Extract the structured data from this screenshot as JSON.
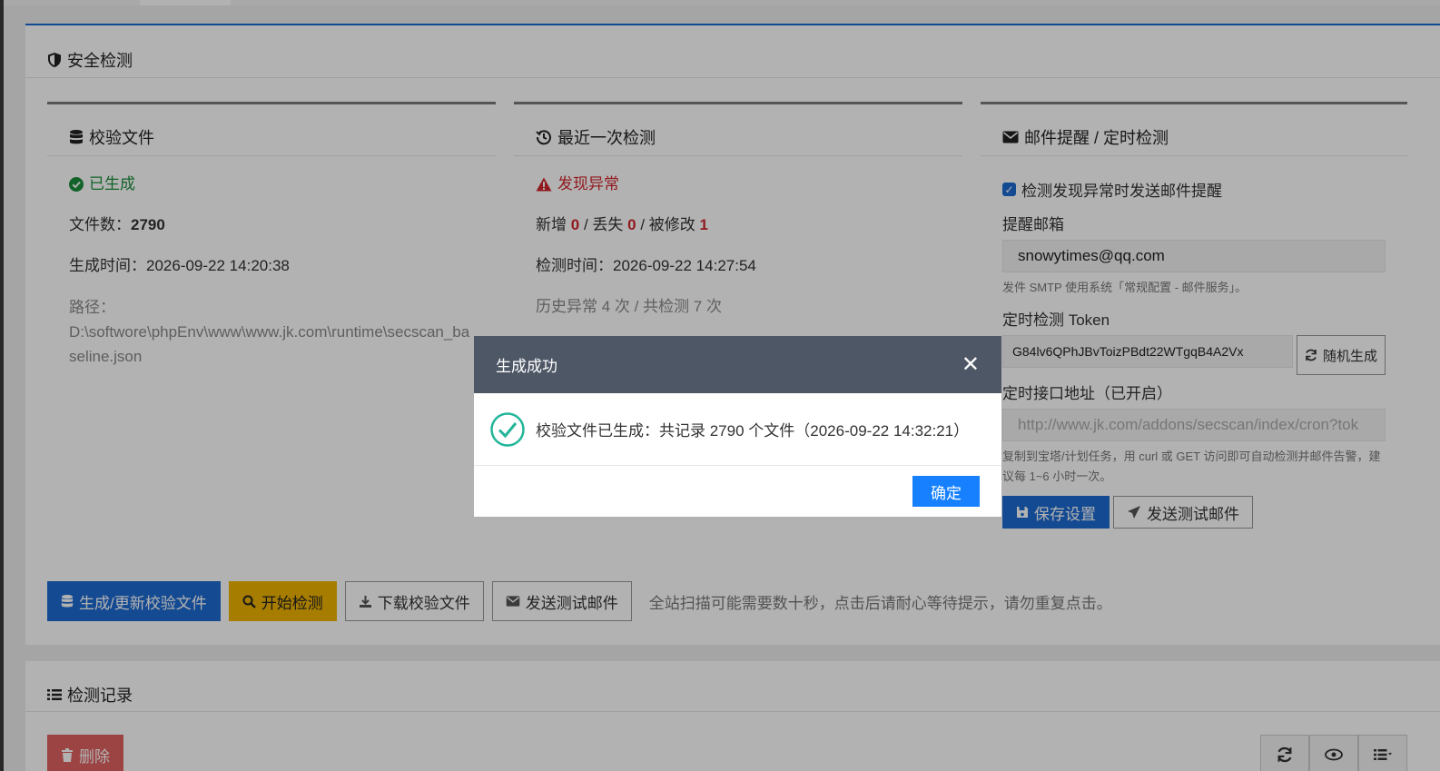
{
  "section": {
    "title": "安全检测"
  },
  "baseline": {
    "title": "校验文件",
    "status": "已生成",
    "file_count_label": "文件数：",
    "file_count": "2790",
    "generated_label": "生成时间：",
    "generated_time": "2026-09-22 14:20:38",
    "path_label": "路径：",
    "path": "D:\\softwore\\phpEnv\\www\\www.jk.com\\runtime\\secscan_baseline.json"
  },
  "last_scan": {
    "title": "最近一次检测",
    "status": "发现异常",
    "added_label": "新增",
    "added": "0",
    "lost_label": "/ 丢失",
    "lost": "0",
    "modified_label": "/ 被修改",
    "modified": "1",
    "scan_time_label": "检测时间：",
    "scan_time": "2026-09-22 14:27:54",
    "history": "历史异常 4 次 / 共检测 7 次"
  },
  "mail": {
    "title": "邮件提醒 / 定时检测",
    "checkbox_label": "检测发现异常时发送邮件提醒",
    "email_label": "提醒邮箱",
    "email_value": "snowytimes@qq.com",
    "smtp_hint": "发件 SMTP 使用系统「常规配置 - 邮件服务」。",
    "token_label": "定时检测 Token",
    "token_value": "G84lv6QPhJBvToizPBdt22WTgqB4A2Vx",
    "random_button": "随机生成",
    "cron_label": "定时接口地址（已开启）",
    "cron_placeholder": "http://www.jk.com/addons/secscan/index/cron?tok",
    "cron_hint": "复制到宝塔/计划任务，用 curl 或 GET 访问即可自动检测并邮件告警，建议每 1~6 小时一次。",
    "save_button": "保存设置",
    "test_button": "发送测试邮件"
  },
  "actions": {
    "generate": "生成/更新校验文件",
    "scan": "开始检测",
    "download": "下载校验文件",
    "test_mail": "发送测试邮件",
    "note": "全站扫描可能需要数十秒，点击后请耐心等待提示，请勿重复点击。"
  },
  "records": {
    "title": "检测记录",
    "delete_button": "删除"
  },
  "modal": {
    "title": "生成成功",
    "message": "校验文件已生成：共记录 2790 个文件（2026-09-22 14:32:21）",
    "ok_button": "确定"
  },
  "colors": {
    "primary": "#1e6bd1",
    "warning": "#f0b400",
    "success": "#1a8f3c",
    "danger": "#d0262d",
    "modal_header": "#4e5766",
    "ok_button": "#1680ff"
  }
}
